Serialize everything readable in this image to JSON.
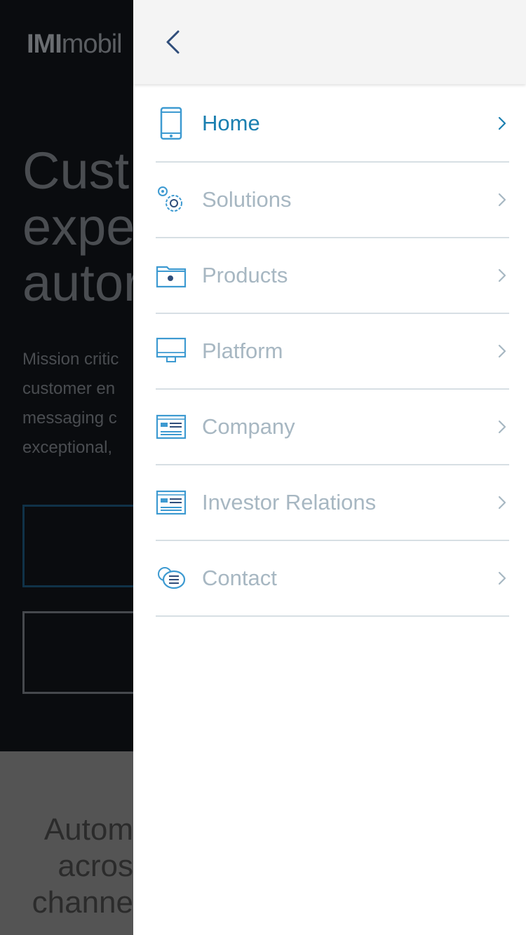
{
  "background": {
    "logo_bold": "IMI",
    "logo_light": "mobil",
    "headline_lines": [
      "Cust",
      "expe",
      "autor"
    ],
    "body_lines": [
      "Mission critic",
      "customer en",
      "messaging c",
      "exceptional,"
    ],
    "footer_lines": [
      "Autom",
      "acros",
      "channe"
    ]
  },
  "drawer": {
    "back_label": "Back",
    "items": [
      {
        "label": "Home",
        "icon": "phone-icon",
        "active": true
      },
      {
        "label": "Solutions",
        "icon": "gears-icon",
        "active": false
      },
      {
        "label": "Products",
        "icon": "folder-icon",
        "active": false
      },
      {
        "label": "Platform",
        "icon": "monitor-icon",
        "active": false
      },
      {
        "label": "Company",
        "icon": "id-card-icon",
        "active": false
      },
      {
        "label": "Investor Relations",
        "icon": "id-card-icon",
        "active": false
      },
      {
        "label": "Contact",
        "icon": "chat-bubbles-icon",
        "active": false
      }
    ]
  },
  "colors": {
    "active": "#1a7fb0",
    "inactive": "#a7b7c2",
    "icon": "#3d9ad1",
    "back_chevron": "#2f4d7a"
  }
}
